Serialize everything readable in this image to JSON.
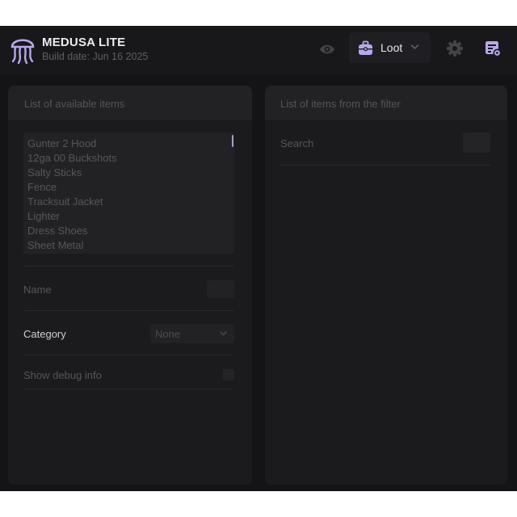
{
  "header": {
    "app_name": "MEDUSA LITE",
    "build_date": "Build date: Jun 16 2025",
    "icons": {
      "logo": "jellyfish-logo-icon",
      "visibility": "eye-icon",
      "mode": "briefcase-icon",
      "settings": "gear-icon",
      "notes": "notes-settings-icon"
    },
    "mode_dropdown": {
      "selected": "Loot"
    }
  },
  "left_panel": {
    "title": "List of available items",
    "items": [
      "Gunter 2 Hood",
      "12ga 00 Buckshots",
      "Salty Sticks",
      "Fence",
      "Tracksuit Jacket",
      "Lighter",
      "Dress Shoes",
      "Sheet Metal"
    ],
    "name_label": "Name",
    "name_value": "",
    "category_label": "Category",
    "category_selected": "None",
    "debug_label": "Show debug info",
    "debug_checked": false
  },
  "right_panel": {
    "title": "List of items from the filter",
    "search_label": "Search",
    "search_value": ""
  },
  "colors": {
    "accent": "#b9a8ec",
    "background": "#141416",
    "panel": "#1b1b1d",
    "panel_header": "#222225",
    "text_dim": "#56555d",
    "text_bright": "#ecebf0"
  }
}
